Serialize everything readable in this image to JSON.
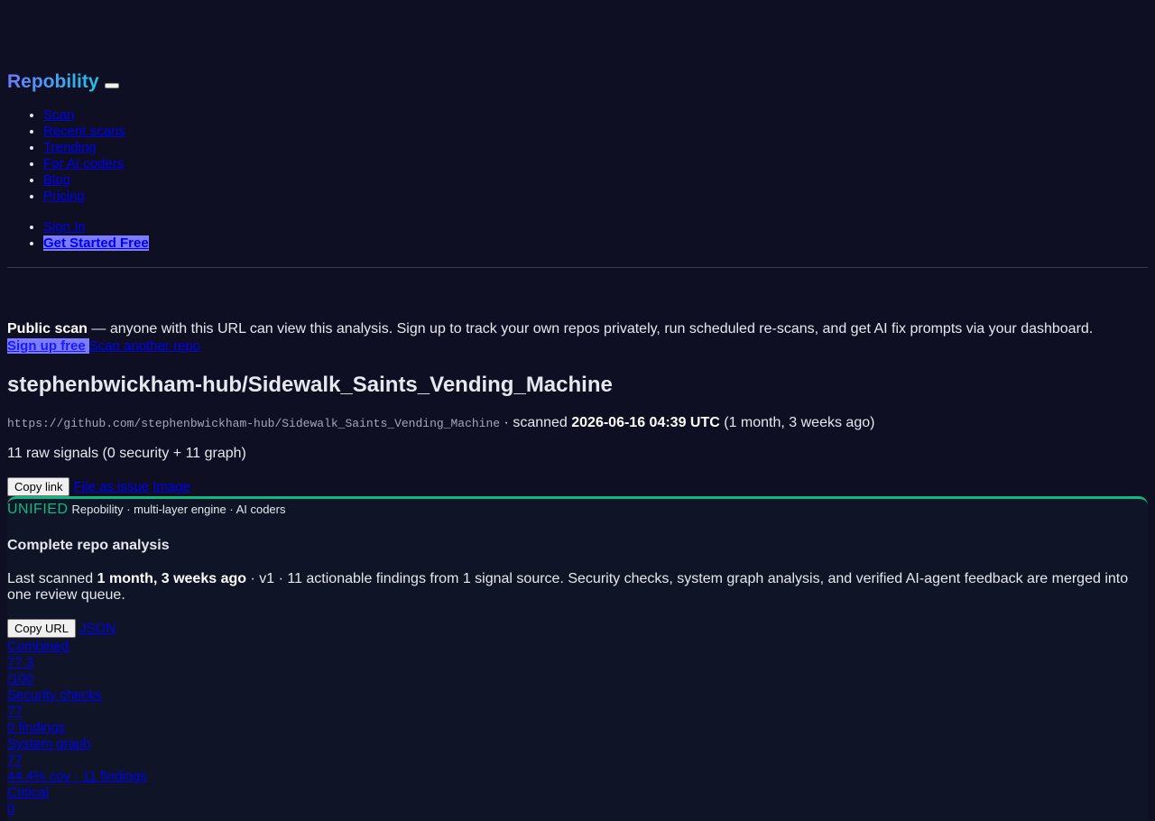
{
  "brand": "Repobility",
  "nav": [
    "Scan",
    "Recent scans",
    "Trending",
    "For AI coders",
    "Blog",
    "Pricing"
  ],
  "auth": {
    "sign_in": "Sign In",
    "get_started": "Get Started Free"
  },
  "notice": {
    "lead": "Public scan",
    "text": " — anyone with this URL can view this analysis. Sign up to track your own repos privately, run scheduled re-scans, and get AI fix prompts via your dashboard.",
    "signup": "Sign up free",
    "scan_another": "Scan another repo"
  },
  "repo": {
    "title": "stephenbwickham-hub/Sidewalk_Saints_Vending_Machine",
    "url": "https://github.com/stephenbwickham-hub/Sidewalk_Saints_Vending_Machine",
    "scanned_prefix": " · scanned ",
    "scanned_at": "2026-06-16 04:39 UTC",
    "scanned_ago": " (1 month, 3 weeks ago)",
    "signals": "11 raw signals (0 security + 11 graph)"
  },
  "actions": {
    "copy_link": "Copy link",
    "file_issue": "File as issue",
    "image": "Image"
  },
  "panel": {
    "tag": "UNIFIED",
    "subtitle": "Repobility · multi-layer engine · AI coders",
    "title": "Complete repo analysis",
    "desc_prefix": "Last scanned ",
    "desc_bold": "1 month, 3 weeks ago",
    "desc_rest": " · v1 · 11 actionable findings from 1 signal source. Security checks, system graph analysis, and verified AI-agent feedback are merged into one review queue.",
    "copy_url": "Copy URL",
    "json": "JSON"
  },
  "metrics": {
    "combined": {
      "label": "Combined",
      "value": "77.3",
      "suffix": "/100"
    },
    "security": {
      "label": "Security checks",
      "value": "77",
      "detail": "0 findings"
    },
    "graph": {
      "label": "System graph",
      "value": "77",
      "detail": "44.4% cov · 11 findings"
    },
    "critical": {
      "label": "Critical",
      "value": "0"
    }
  }
}
